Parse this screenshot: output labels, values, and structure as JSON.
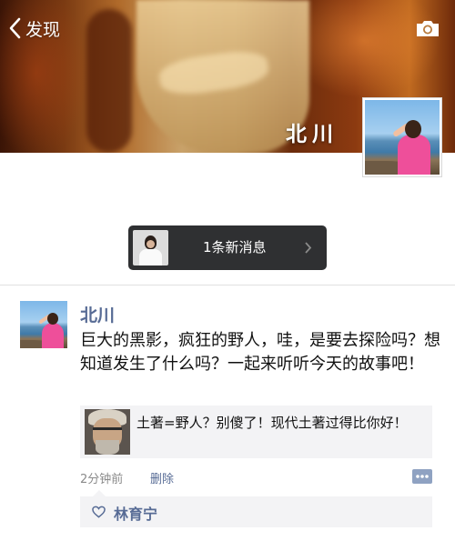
{
  "header": {
    "back_label": "发现",
    "profile_name": "北川"
  },
  "notification": {
    "label": "1条新消息"
  },
  "post": {
    "author": "北川",
    "text": "巨大的黑影，疯狂的野人，哇，是要去探险吗？想知道发生了什么吗？一起来听听今天的故事吧！",
    "link_title": "土著=野人？别傻了！现代土著过得比你好！",
    "time": "2分钟前",
    "delete_label": "删除",
    "likes": [
      "林育宁"
    ]
  },
  "colors": {
    "link_blue": "#576b95",
    "card_bg": "#f3f3f5",
    "notification_bg": "#2f3032"
  },
  "icons": {
    "back": "chevron-left-icon",
    "camera": "camera-icon",
    "chevron": "chevron-right-icon",
    "comment": "comment-icon",
    "like": "heart-icon"
  }
}
